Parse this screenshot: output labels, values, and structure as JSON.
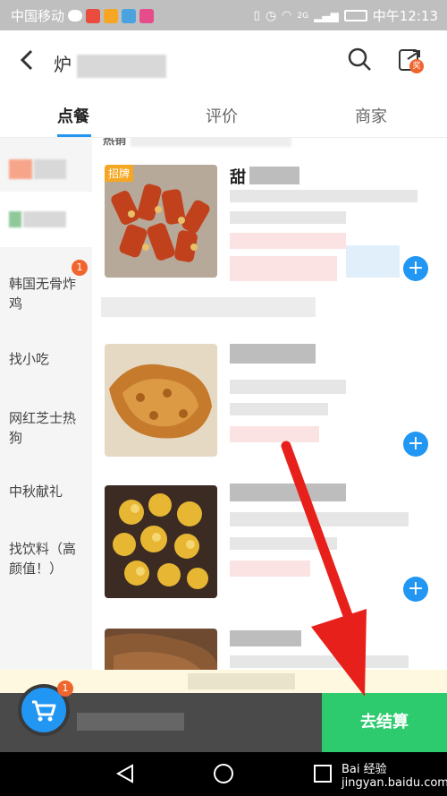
{
  "status_bar": {
    "carrier": "中国移动",
    "network": "2G",
    "time": "中午12:13"
  },
  "header": {
    "back_icon": "chevron-left-icon",
    "title_initial": "炉",
    "search_icon": "search-icon",
    "share_icon": "share-icon",
    "share_badge": "奖"
  },
  "tabs": [
    {
      "label": "点餐",
      "active": true
    },
    {
      "label": "评价",
      "active": false
    },
    {
      "label": "商家",
      "active": false
    }
  ],
  "section_header": "热销",
  "sidebar": {
    "items": [
      {
        "label": "韩国无骨炸鸡",
        "badge": "1"
      },
      {
        "label": "找小吃"
      },
      {
        "label": "网红芝士热狗"
      },
      {
        "label": "中秋献礼"
      },
      {
        "label": "找饮料（高颜值！）"
      }
    ]
  },
  "products": [
    {
      "tag": "招牌",
      "name_initial": "甜"
    },
    {},
    {},
    {}
  ],
  "cart": {
    "badge": "1",
    "checkout_label": "去结算"
  },
  "watermark": "Bai 经验 jingyan.baidu.com",
  "colors": {
    "accent": "#2196f3",
    "checkout": "#2ecb6e",
    "badge": "#f0652d",
    "arrow": "#e8201b"
  }
}
